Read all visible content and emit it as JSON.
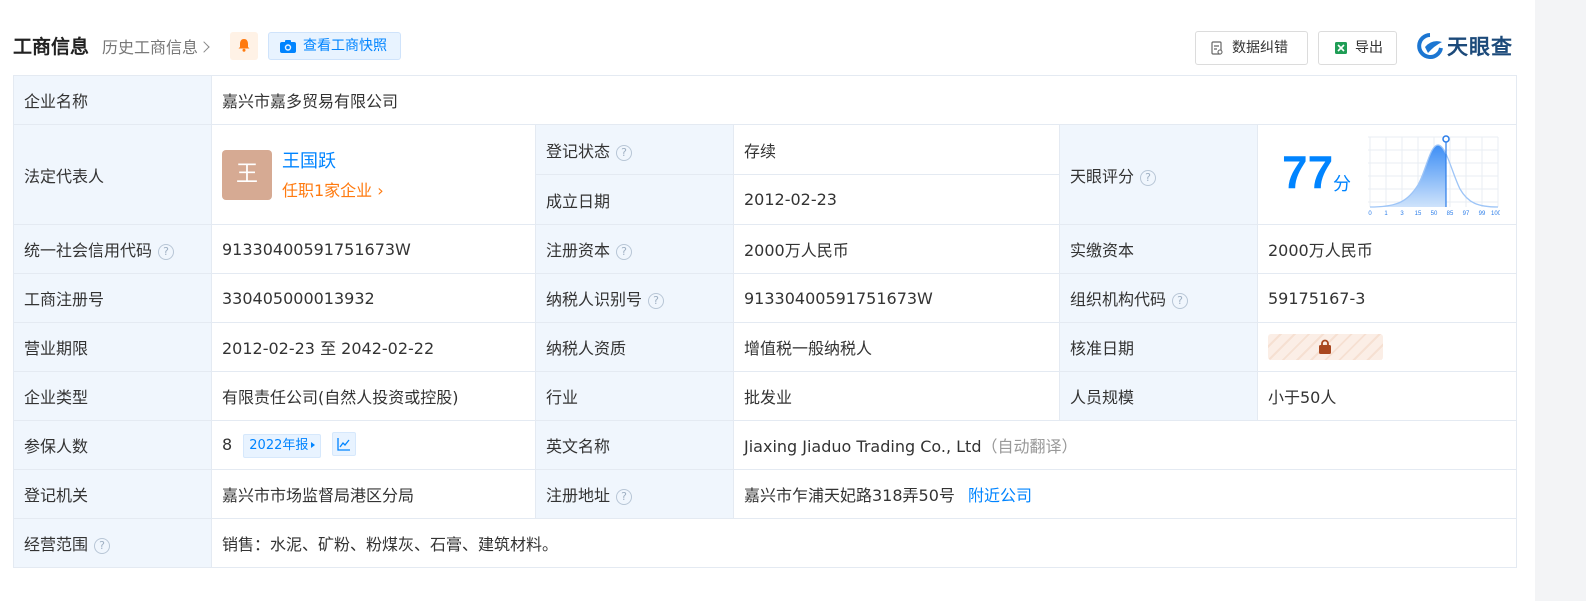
{
  "header": {
    "title": "工商信息",
    "history_label": "历史工商信息",
    "snapshot_label": "查看工商快照",
    "error_label": "数据纠错",
    "export_label": "导出",
    "logo_text": "天眼查"
  },
  "rows": {
    "company_name": {
      "label": "企业名称",
      "value": "嘉兴市嘉多贸易有限公司"
    },
    "legal_rep": {
      "label": "法定代表人",
      "avatar_char": "王",
      "name": "王国跃",
      "sub": "任职1家企业",
      "sub_arrow": "›"
    },
    "reg_status": {
      "label": "登记状态",
      "value": "存续"
    },
    "established": {
      "label": "成立日期",
      "value": "2012-02-23"
    },
    "tianyan_score": {
      "label": "天眼评分",
      "score": "77",
      "unit": "分",
      "axis_ticks": [
        "0",
        "1",
        "3",
        "15",
        "50",
        "85",
        "97",
        "99",
        "100"
      ]
    },
    "credit_code": {
      "label": "统一社会信用代码",
      "value": "91330400591751673W"
    },
    "reg_capital": {
      "label": "注册资本",
      "value": "2000万人民币"
    },
    "paid_capital": {
      "label": "实缴资本",
      "value": "2000万人民币"
    },
    "reg_number": {
      "label": "工商注册号",
      "value": "330405000013932"
    },
    "taxpayer_id": {
      "label": "纳税人识别号",
      "value": "91330400591751673W"
    },
    "org_code": {
      "label": "组织机构代码",
      "value": "59175167-3"
    },
    "business_term": {
      "label": "营业期限",
      "value": "2012-02-23 至 2042-02-22"
    },
    "taxpayer_qual": {
      "label": "纳税人资质",
      "value": "增值税一般纳税人"
    },
    "approval_date": {
      "label": "核准日期"
    },
    "company_type": {
      "label": "企业类型",
      "value": "有限责任公司(自然人投资或控股)"
    },
    "industry": {
      "label": "行业",
      "value": "批发业"
    },
    "staff_size": {
      "label": "人员规模",
      "value": "小于50人"
    },
    "insured": {
      "label": "参保人数",
      "value": "8",
      "year_report": "2022年报"
    },
    "english_name": {
      "label": "英文名称",
      "value": "Jiaxing Jiaduo Trading Co., Ltd",
      "note": "（自动翻译）"
    },
    "reg_authority": {
      "label": "登记机关",
      "value": "嘉兴市市场监督局港区分局"
    },
    "reg_address": {
      "label": "注册地址",
      "value": "嘉兴市乍浦天妃路318弄50号",
      "link": "附近公司"
    },
    "business_scope": {
      "label": "经营范围",
      "value": "销售：水泥、矿粉、粉煤灰、石膏、建筑材料。"
    }
  },
  "question_mark": "?",
  "colors": {
    "accent": "#0084ff",
    "label_bg": "#f0f6fd",
    "green": "#19a55a",
    "orange": "#ff7a0f"
  }
}
